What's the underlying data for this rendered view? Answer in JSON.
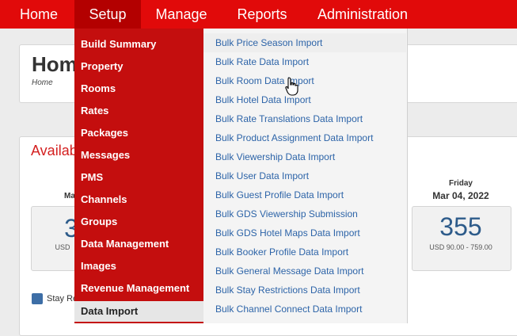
{
  "topnav": {
    "items": [
      {
        "label": "Home"
      },
      {
        "label": "Setup"
      },
      {
        "label": "Manage"
      },
      {
        "label": "Reports"
      },
      {
        "label": "Administration"
      }
    ]
  },
  "page": {
    "title": "Hom",
    "breadcrumb": "Home",
    "availability_title": "Availab"
  },
  "availability": {
    "left_day": "Ma",
    "left_number": "3",
    "left_usd": "USD",
    "right_day": "Friday",
    "right_date": "Mar 04, 2022",
    "right_number": "355",
    "right_usd": "USD 90.00 - 759.00",
    "legend": "Stay Re"
  },
  "setup_menu": {
    "items": [
      {
        "label": "Build Summary"
      },
      {
        "label": "Property"
      },
      {
        "label": "Rooms"
      },
      {
        "label": "Rates"
      },
      {
        "label": "Packages"
      },
      {
        "label": "Messages"
      },
      {
        "label": "PMS"
      },
      {
        "label": "Channels"
      },
      {
        "label": "Groups"
      },
      {
        "label": "Data Management"
      },
      {
        "label": "Images"
      },
      {
        "label": "Revenue Management"
      },
      {
        "label": "Data Import"
      }
    ],
    "selected": "Data Import"
  },
  "submenu": {
    "items": [
      {
        "label": "Bulk Price Season Import"
      },
      {
        "label": "Bulk Rate Data Import"
      },
      {
        "label": "Bulk Room Data Import"
      },
      {
        "label": "Bulk Hotel Data Import"
      },
      {
        "label": "Bulk Rate Translations Data Import"
      },
      {
        "label": "Bulk Product Assignment Data Import"
      },
      {
        "label": "Bulk Viewership Data Import"
      },
      {
        "label": "Bulk User Data Import"
      },
      {
        "label": "Bulk Guest Profile Data Import"
      },
      {
        "label": "Bulk GDS Viewership Submission"
      },
      {
        "label": "Bulk GDS Hotel Maps Data Import"
      },
      {
        "label": "Bulk Booker Profile Data Import"
      },
      {
        "label": "Bulk General Message Data Import"
      },
      {
        "label": "Bulk Stay Restrictions Data Import"
      },
      {
        "label": "Bulk Channel Connect Data Import"
      }
    ]
  },
  "colors": {
    "nav_red": "#e10a0a",
    "menu_red": "#c40e0e",
    "link_blue": "#2d64a8"
  }
}
